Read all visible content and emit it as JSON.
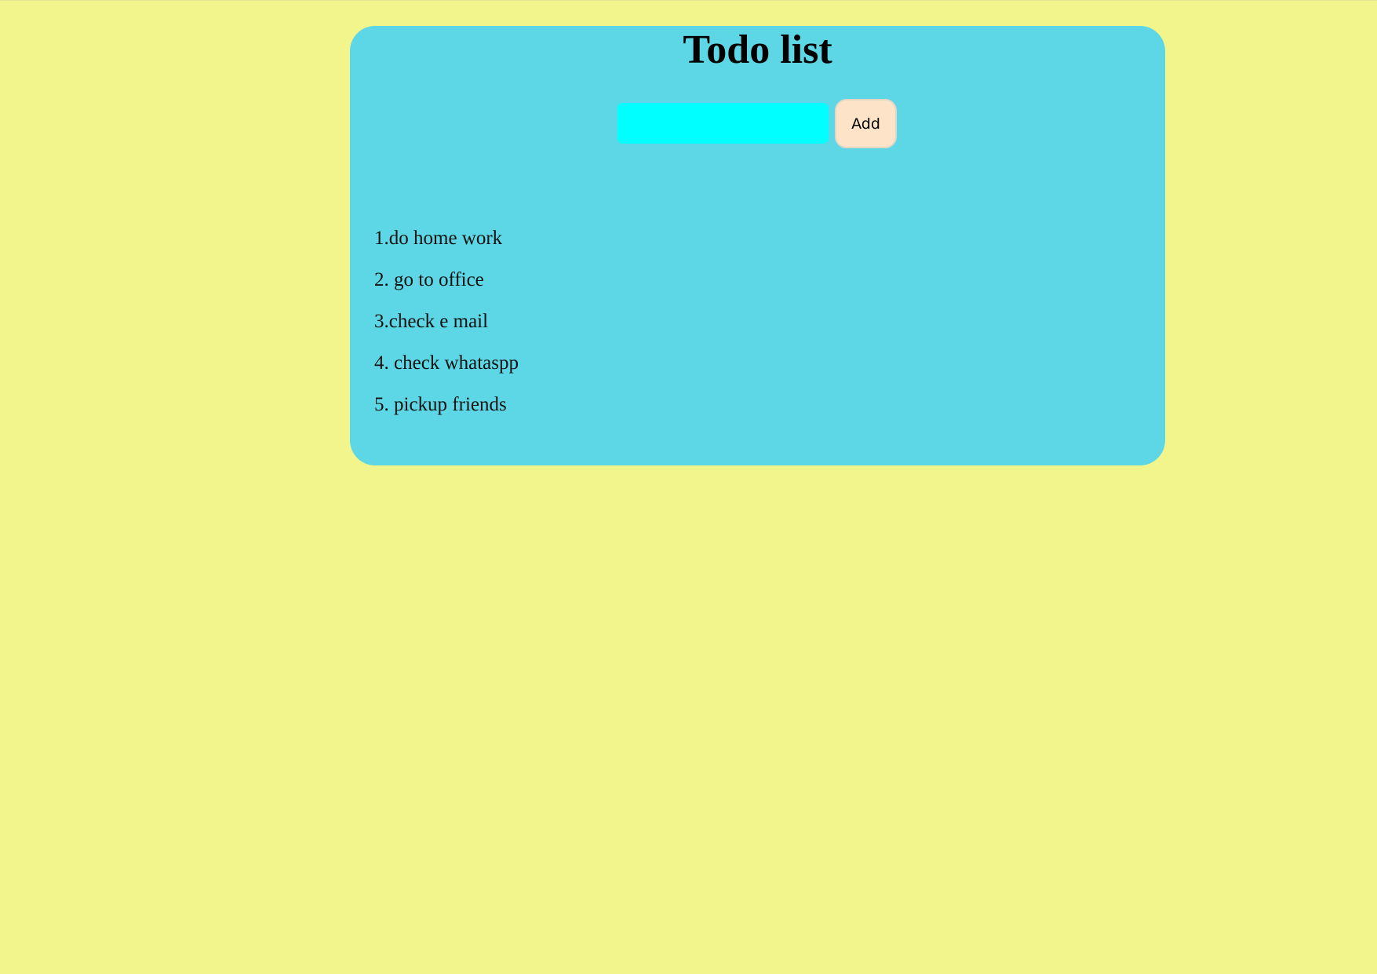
{
  "page": {
    "background_color": "#f2f48c",
    "card_color": "#5dd7e5"
  },
  "app": {
    "title": "Todo list"
  },
  "form": {
    "input_value": "",
    "input_color": "#00ffff",
    "add_label": "Add",
    "add_color": "#fde4c8"
  },
  "todos": [
    {
      "text": "1.do home work"
    },
    {
      "text": "2. go to office"
    },
    {
      "text": "3.check e mail"
    },
    {
      "text": "4. check whataspp"
    },
    {
      "text": "5. pickup friends"
    }
  ]
}
